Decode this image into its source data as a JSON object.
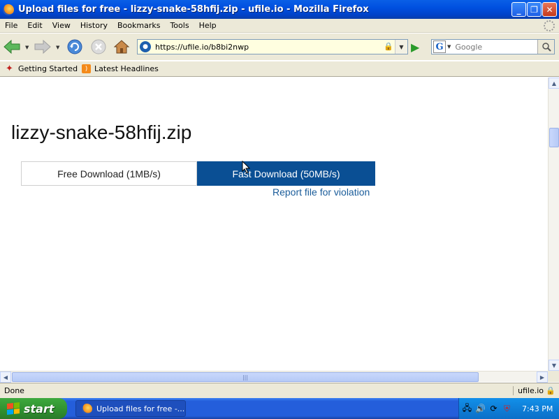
{
  "window": {
    "title": "Upload files for free - lizzy-snake-58hfij.zip - ufile.io - Mozilla Firefox",
    "minimize_glyph": "_",
    "restore_glyph": "❐",
    "close_glyph": "✕"
  },
  "menu": {
    "items": [
      "File",
      "Edit",
      "View",
      "History",
      "Bookmarks",
      "Tools",
      "Help"
    ]
  },
  "navbar": {
    "url": "https://ufile.io/b8bi2nwp",
    "search_placeholder": "Google",
    "search_engine_glyph": "G",
    "icons": {
      "back": "back-arrow-icon",
      "forward": "forward-arrow-icon",
      "reload": "reload-icon",
      "stop": "stop-icon",
      "home": "home-icon",
      "go": "go-arrow-icon",
      "search": "magnifier-icon"
    }
  },
  "bookmarks": {
    "items": [
      {
        "label": "Getting Started",
        "icon": "firefox-bookmark-icon"
      },
      {
        "label": "Latest Headlines",
        "icon": "rss-feed-icon"
      }
    ]
  },
  "page": {
    "filename": "lizzy-snake-58hfij.zip",
    "free_download_label": "Free Download (1MB/s)",
    "fast_download_label": "Fast Download (50MB/s)",
    "report_link": "Report file for violation",
    "fast_download_color": "#0a4f94",
    "link_color": "#1a5c9a"
  },
  "status": {
    "text": "Done",
    "host": "ufile.io"
  },
  "taskbar": {
    "start_label": "start",
    "task_label": "Upload files for free -...",
    "clock": "7:43 PM"
  }
}
